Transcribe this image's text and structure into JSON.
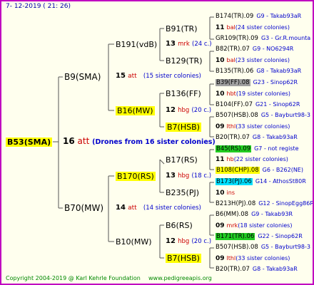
{
  "header": {
    "date": "7-  12-2019  (  21:  26)"
  },
  "root": {
    "name": "B53(SMA)",
    "count": "16",
    "code": "att",
    "note": "(Drones from 16 sister colonies)"
  },
  "gen1": [
    {
      "name": "B9(SMA)",
      "count": "15",
      "code": "att",
      "note": "(15 sister colonies)"
    },
    {
      "name": "B70(MW)",
      "count": "14",
      "code": "att",
      "note": "(14 sister colonies)"
    }
  ],
  "gen2": [
    {
      "name": "B191(vdB)",
      "count": "13",
      "code": "mrk",
      "note": "(24 c.)"
    },
    {
      "name": "B16(MW)",
      "count": "12",
      "code": "hbg",
      "note": "(20 c.)"
    },
    {
      "name": "B170(RS)",
      "count": "13",
      "code": "hbg",
      "note": "(18 c.)"
    },
    {
      "name": "B10(MW)",
      "count": "12",
      "code": "hbg",
      "note": "(20 c.)"
    }
  ],
  "gen3": [
    "B91(TR)",
    "B129(TR)",
    "B136(FF)",
    "B7(HSB)",
    "B17(RS)",
    "B235(PJ)",
    "B6(RS)",
    "B7(HSB)"
  ],
  "gen4": [
    {
      "name": "B174(TR).09",
      "loc": "G9 - Takab93aR"
    },
    {
      "count": "11",
      "code": "bal",
      "note": "(24 sister colonies)"
    },
    {
      "name": "GR109(TR).09",
      "loc": "G3 - Gr.R.mounta"
    },
    {
      "name": "B82(TR).07",
      "loc": "G9 - NO6294R"
    },
    {
      "count": "10",
      "code": "bal",
      "note": "(23 sister colonies)"
    },
    {
      "name": "B135(TR).06",
      "loc": "G8 - Takab93aR"
    },
    {
      "name": "B39(FF).08",
      "loc": "G23 - Sinop62R"
    },
    {
      "count": "10",
      "code": "hbt",
      "note": "(19 sister colonies)"
    },
    {
      "name": "B104(FF).07",
      "loc": "G21 - Sinop62R"
    },
    {
      "name": "B507(HSB).08",
      "loc": "G5 - Bayburt98-3"
    },
    {
      "count": "09",
      "code": "lthl",
      "note": "(33 sister colonies)"
    },
    {
      "name": "B20(TR).07",
      "loc": "G8 - Takab93aR"
    },
    {
      "name": "B45(RS).09",
      "loc": "G7 - not registe"
    },
    {
      "count": "11",
      "code": "hb",
      "note": "(22 sister colonies)"
    },
    {
      "name": "B108(CHP).08",
      "loc": "G6 - B262(NE)"
    },
    {
      "name": "B173(PJ).06",
      "loc": "G14 - AthosSt80R"
    },
    {
      "count": "10",
      "code": "ins",
      "note": ""
    },
    {
      "name": "B213H(PJ).08",
      "loc": "G12 - SinopEgg86R"
    },
    {
      "name": "B6(MM).08",
      "loc": "G9 - Takab93R"
    },
    {
      "count": "09",
      "code": "mrk",
      "note": "(18 sister colonies)"
    },
    {
      "name": "B171(TR).06",
      "loc": "G22 - Sinop62R"
    },
    {
      "name": "B507(HSB).08",
      "loc": "G5 - Bayburt98-3"
    },
    {
      "count": "09",
      "code": "lthl",
      "note": "(33 sister colonies)"
    },
    {
      "name": "B20(TR).07",
      "loc": "G8 - Takab93aR"
    }
  ],
  "footer": {
    "copyright": "Copyright 2004-2019 @ Karl Kehrle Foundation",
    "site": "www.pedigreeapis.org"
  },
  "colors": {
    "frame": "#c000c0",
    "background": "#ffffee",
    "highlight_yellow": "#ffff00",
    "highlight_gray": "#a0a0a0",
    "highlight_green": "#22cc22",
    "highlight_cyan": "#00e0ff",
    "code_red": "#cc0000",
    "note_blue": "#0000cc",
    "footer_green": "#008800"
  }
}
